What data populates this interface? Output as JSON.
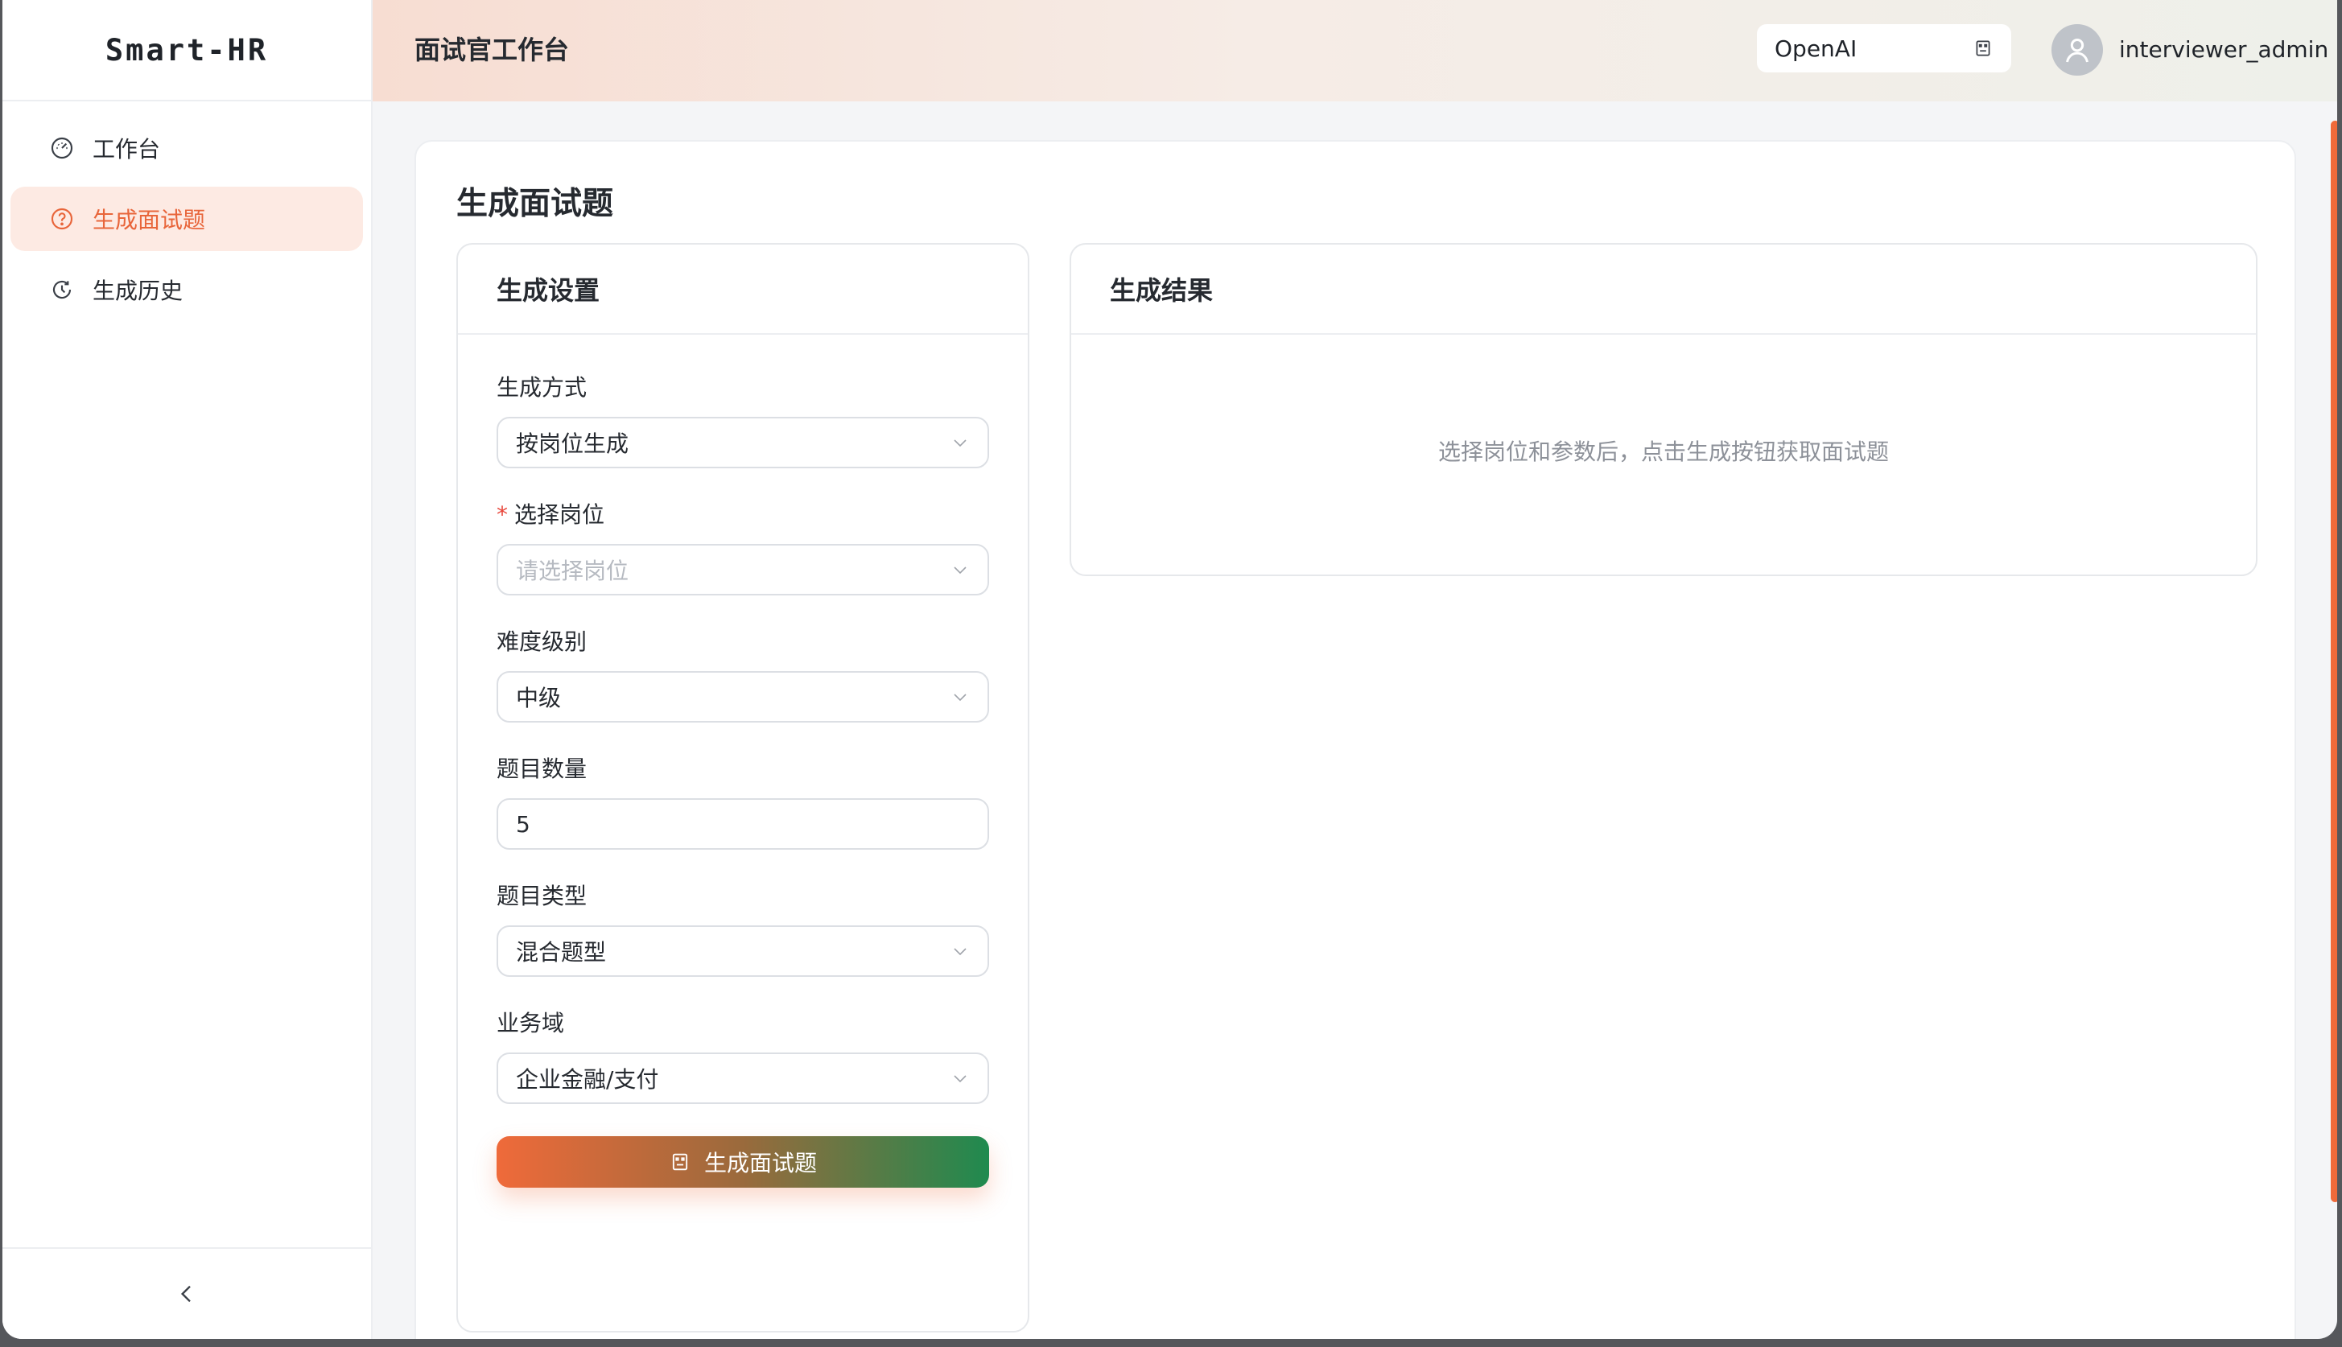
{
  "app": {
    "logo": "Smart-HR",
    "header_title": "面试官工作台",
    "model_select_value": "OpenAI",
    "username": "interviewer_admin"
  },
  "sidebar": {
    "items": [
      {
        "label": "工作台",
        "icon": "dashboard-icon",
        "active": false
      },
      {
        "label": "生成面试题",
        "icon": "question-circle-icon",
        "active": true
      },
      {
        "label": "生成历史",
        "icon": "history-icon",
        "active": false
      }
    ],
    "collapse_icon": "chevron-left-icon"
  },
  "main": {
    "page_title": "生成面试题",
    "settings_panel": {
      "title": "生成设置",
      "fields": {
        "method": {
          "label": "生成方式",
          "value": "按岗位生成"
        },
        "position": {
          "label": "选择岗位",
          "required_mark": "*",
          "placeholder": "请选择岗位"
        },
        "difficulty": {
          "label": "难度级别",
          "value": "中级"
        },
        "count": {
          "label": "题目数量",
          "value": "5"
        },
        "type": {
          "label": "题目类型",
          "value": "混合题型"
        },
        "domain": {
          "label": "业务域",
          "value": "企业金融/支付"
        }
      },
      "submit_label": "生成面试题"
    },
    "result_panel": {
      "title": "生成结果",
      "empty_text": "选择岗位和参数后，点击生成按钮获取面试题"
    }
  },
  "colors": {
    "accent": "#e8653a",
    "active_bg": "#fdeae3",
    "button_gradient_start": "#ef6a3a",
    "button_gradient_end": "#1f8a4f"
  }
}
